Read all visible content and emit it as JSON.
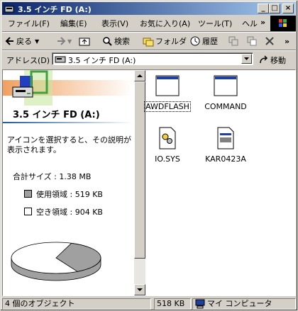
{
  "window": {
    "title": "3.5 インチ FD (A:)",
    "min_glyph": "_",
    "max_glyph": "□",
    "close_glyph": "×"
  },
  "menu": {
    "items": [
      "ファイル(F)",
      "編集(E)",
      "表示(V)",
      "お気に入り(A)",
      "ツール(T)",
      "ヘル"
    ],
    "overflow": "»"
  },
  "toolbar": {
    "back": "戻る",
    "search": "検索",
    "folders": "フォルダ",
    "history": "履歴",
    "overflow": "»"
  },
  "address": {
    "label": "アドレス(D)",
    "value": "3.5 インチ FD (A:)",
    "go": "移動"
  },
  "left_pane": {
    "folder_title": "3.5 インチ FD (A:)",
    "description": "アイコンを選択すると、その説明が表示されます。",
    "total": "合計サイズ : 1.38 MB",
    "used": "使用領域 : 519 KB",
    "free": "空き領域 : 904 KB",
    "used_color": "#a0a0a0",
    "free_color": "#ffffff",
    "used_fraction": 0.365
  },
  "files": [
    {
      "name": "AWDFLASH",
      "icon": "application-window-icon"
    },
    {
      "name": "COMMAND",
      "icon": "application-window-icon"
    },
    {
      "name": "IO.SYS",
      "icon": "system-file-gear-icon"
    },
    {
      "name": "KAR0423A",
      "icon": "document-file-icon"
    }
  ],
  "status": {
    "objects": "4 個のオブジェクト",
    "size": "518 KB",
    "location": "マイ コンピュータ"
  },
  "colors": {
    "title_start": "#0a246a",
    "title_end": "#a6caf0",
    "face": "#d4d0c8"
  }
}
